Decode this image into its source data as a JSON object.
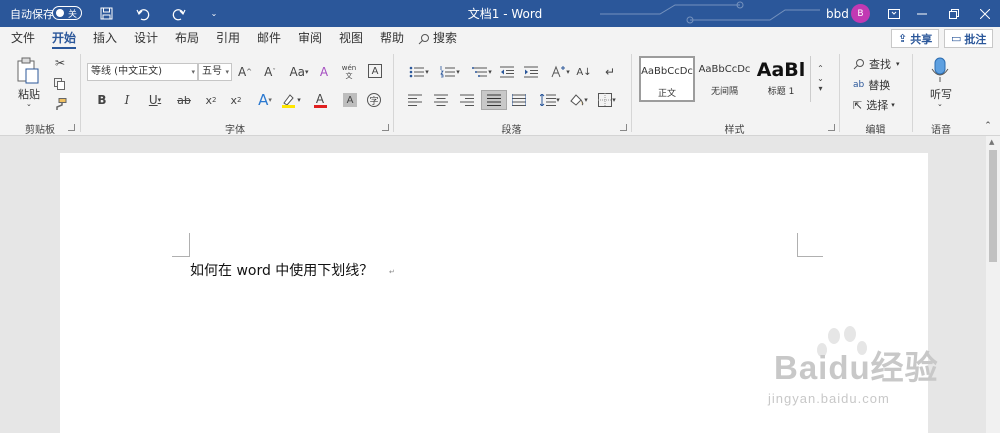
{
  "titlebar": {
    "autosave_label": "自动保存",
    "autosave_state": "关",
    "title": "文档1 - Word",
    "user_name": "bbd",
    "avatar_initial": "B",
    "accent_color": "#2b579a"
  },
  "menu": {
    "tabs": [
      "文件",
      "开始",
      "插入",
      "设计",
      "布局",
      "引用",
      "邮件",
      "审阅",
      "视图",
      "帮助"
    ],
    "active_tab": "开始",
    "search_label": "搜索",
    "share_label": "共享",
    "comment_label": "批注"
  },
  "ribbon": {
    "clipboard": {
      "paste_label": "粘贴",
      "group_label": "剪贴板"
    },
    "font": {
      "font_name": "等线 (中文正文)",
      "font_size": "五号",
      "group_label": "字体",
      "phonetic_top": "wén",
      "phonetic_bottom": "文"
    },
    "paragraph": {
      "group_label": "段落"
    },
    "styles": {
      "group_label": "样式",
      "items": [
        {
          "sample": "AaBbCcDc",
          "name": "正文"
        },
        {
          "sample": "AaBbCcDc",
          "name": "无间隔"
        },
        {
          "sample": "AaBl",
          "name": "标题 1"
        }
      ]
    },
    "editing": {
      "group_label": "编辑",
      "find_label": "查找",
      "replace_label": "替换",
      "select_label": "选择"
    },
    "voice": {
      "dictate_label": "听写",
      "group_label": "语音"
    }
  },
  "document": {
    "text": "如何在 word 中使用下划线？",
    "paragraph_mark": "↵"
  },
  "watermark": {
    "brand": "Baidu经验",
    "url": "jingyan.baidu.com"
  }
}
